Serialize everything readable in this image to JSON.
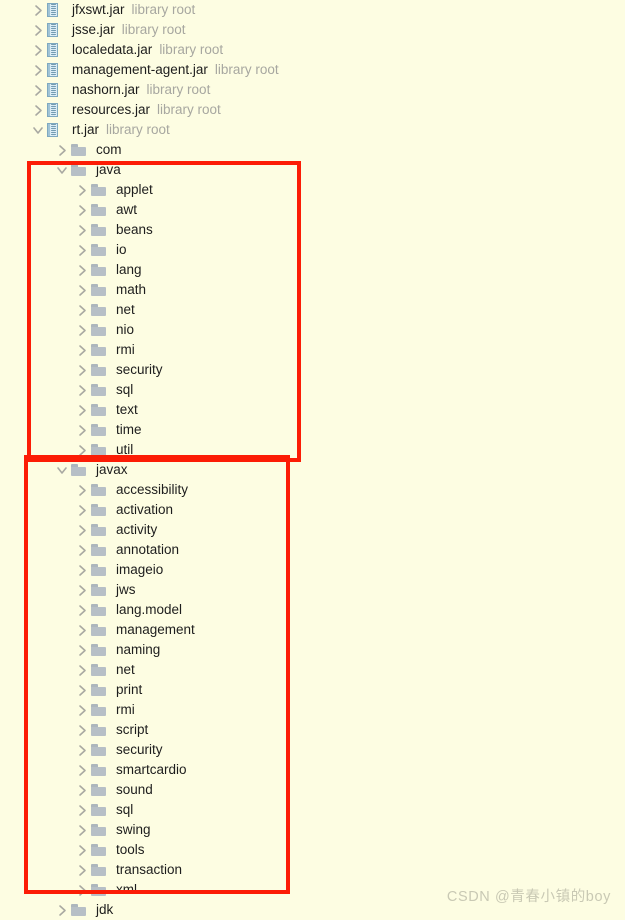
{
  "background_color": "#fdfde2",
  "annotation_color": "#fc1c05",
  "tree": {
    "jars": [
      {
        "name": "jfxswt.jar",
        "tag": "library root",
        "expanded": false
      },
      {
        "name": "jsse.jar",
        "tag": "library root",
        "expanded": false
      },
      {
        "name": "localedata.jar",
        "tag": "library root",
        "expanded": false
      },
      {
        "name": "management-agent.jar",
        "tag": "library root",
        "expanded": false
      },
      {
        "name": "nashorn.jar",
        "tag": "library root",
        "expanded": false
      },
      {
        "name": "resources.jar",
        "tag": "library root",
        "expanded": false
      },
      {
        "name": "rt.jar",
        "tag": "library root",
        "expanded": true
      }
    ],
    "rt_children": [
      {
        "name": "com",
        "expanded": false
      },
      {
        "name": "java",
        "expanded": true
      },
      {
        "name": "javax",
        "expanded": true
      },
      {
        "name": "jdk",
        "expanded": false
      }
    ],
    "java_packages": [
      "applet",
      "awt",
      "beans",
      "io",
      "lang",
      "math",
      "net",
      "nio",
      "rmi",
      "security",
      "sql",
      "text",
      "time",
      "util"
    ],
    "javax_packages": [
      "accessibility",
      "activation",
      "activity",
      "annotation",
      "imageio",
      "jws",
      "lang.model",
      "management",
      "naming",
      "net",
      "print",
      "rmi",
      "script",
      "security",
      "smartcardio",
      "sound",
      "sql",
      "swing",
      "tools",
      "transaction",
      "xml"
    ]
  },
  "watermark": {
    "text": "CSDN @青春小镇的boy"
  },
  "icons": {
    "jar": "jar-file-icon",
    "folder": "folder-icon",
    "collapsed": "chevron-right-icon",
    "expanded": "chevron-down-icon"
  }
}
